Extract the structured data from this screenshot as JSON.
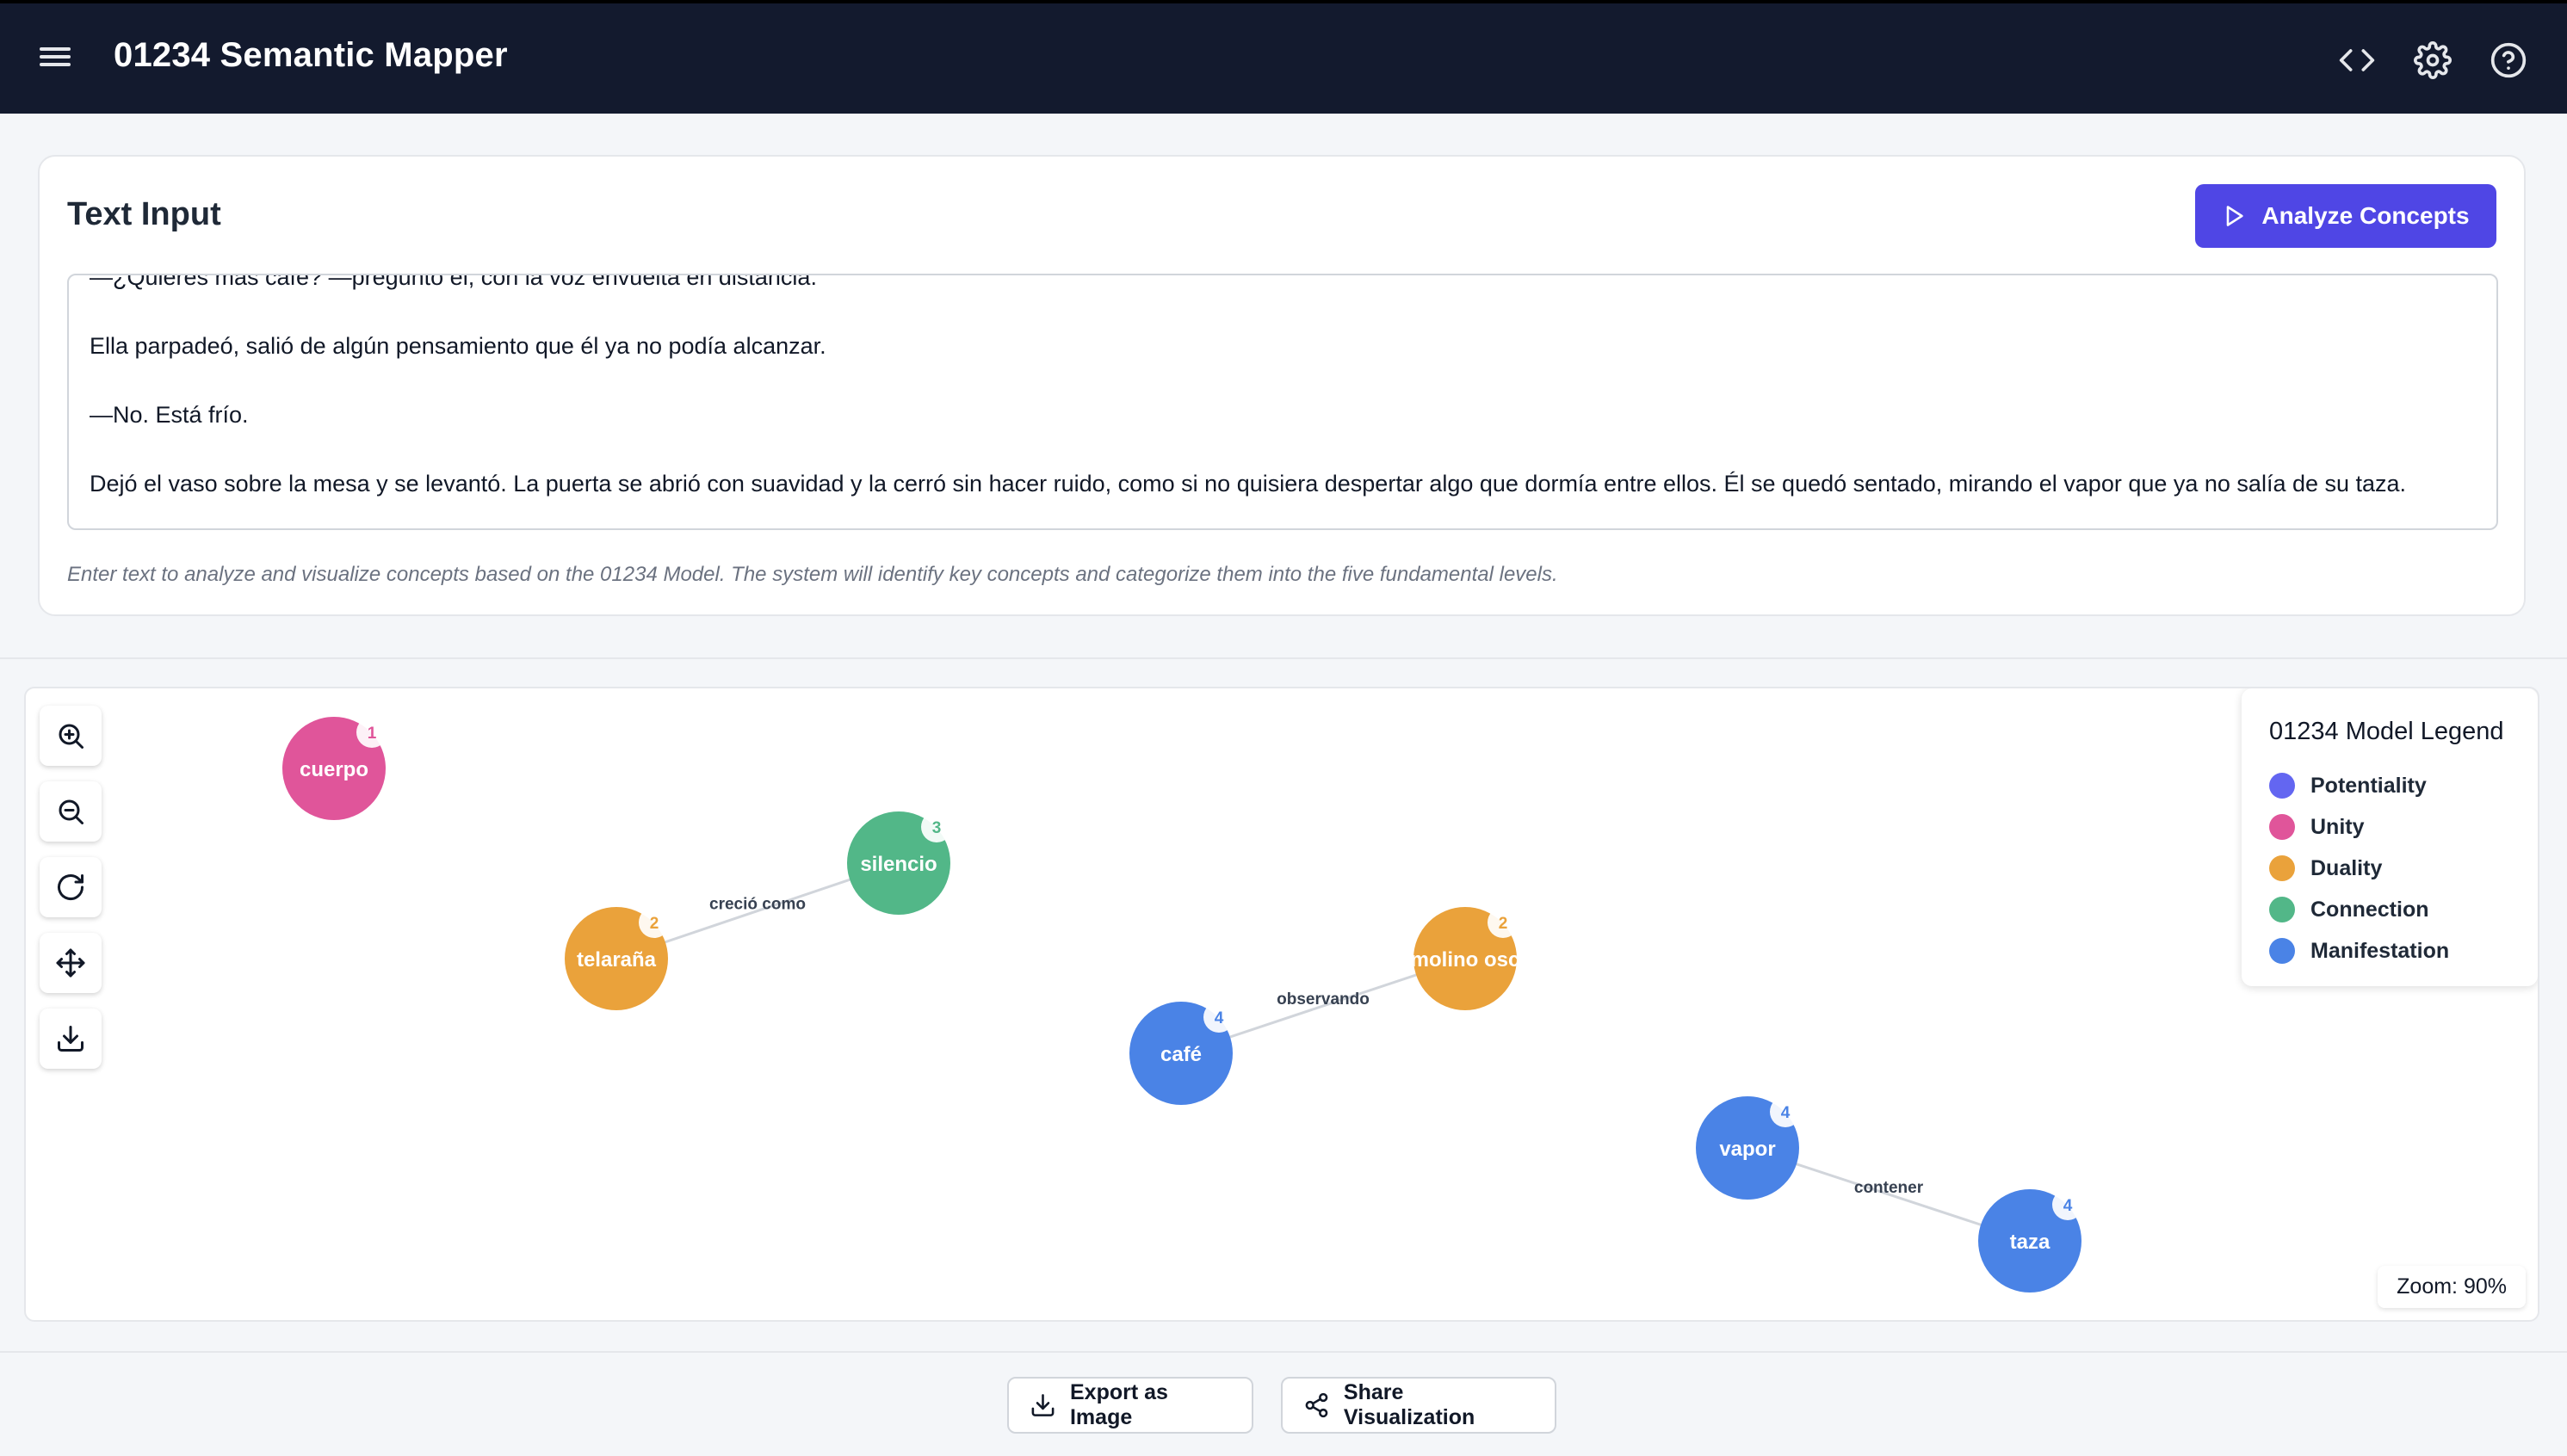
{
  "header": {
    "title": "01234 Semantic Mapper",
    "icons": [
      "menu-icon",
      "code-icon",
      "gear-icon",
      "help-icon"
    ]
  },
  "input_card": {
    "title": "Text Input",
    "analyze_label": "Analyze Concepts",
    "text_lines": [
      "—¿Quieres más café? —preguntó él, con la voz envuelta en distancia.",
      "Ella parpadeó, salió de algún pensamiento que él ya no podía alcanzar.",
      "—No. Está frío.",
      "Dejó el vaso sobre la mesa y se levantó. La puerta se abrió con suavidad y la cerró sin hacer ruido, como si no quisiera despertar algo que dormía entre ellos. Él se quedó sentado, mirando el vapor que ya no salía de su taza."
    ],
    "hint": "Enter text to analyze and visualize concepts based on the 01234 Model. The system will identify key concepts and categorize them into the five fundamental levels."
  },
  "legend": {
    "title": "01234 Model Legend",
    "items": [
      {
        "label": "Potentiality",
        "color": "#6366f1"
      },
      {
        "label": "Unity",
        "color": "#e0559a"
      },
      {
        "label": "Duality",
        "color": "#eaa23b"
      },
      {
        "label": "Connection",
        "color": "#52b788"
      },
      {
        "label": "Manifestation",
        "color": "#4a83e6"
      }
    ]
  },
  "graph": {
    "nodes": [
      {
        "id": "cuerpo",
        "label": "cuerpo",
        "level": 1
      },
      {
        "id": "silencio",
        "label": "silencio",
        "level": 3
      },
      {
        "id": "telarana",
        "label": "telaraña",
        "level": 2
      },
      {
        "id": "molino",
        "label": "molino osc",
        "level": 2
      },
      {
        "id": "cafe",
        "label": "café",
        "level": 4
      },
      {
        "id": "vapor",
        "label": "vapor",
        "level": 4
      },
      {
        "id": "taza",
        "label": "taza",
        "level": 4
      }
    ],
    "edges": [
      {
        "from": "telarana",
        "to": "silencio",
        "label": "creció como"
      },
      {
        "from": "cafe",
        "to": "molino",
        "label": "observando"
      },
      {
        "from": "vapor",
        "to": "taza",
        "label": "contener"
      }
    ]
  },
  "toolbar": {
    "tools": [
      "zoom-in-icon",
      "zoom-out-icon",
      "reset-icon",
      "move-icon",
      "download-icon"
    ]
  },
  "zoom_label": "Zoom: 90%",
  "footer": {
    "export_label": "Export as Image",
    "share_label": "Share Visualization"
  }
}
